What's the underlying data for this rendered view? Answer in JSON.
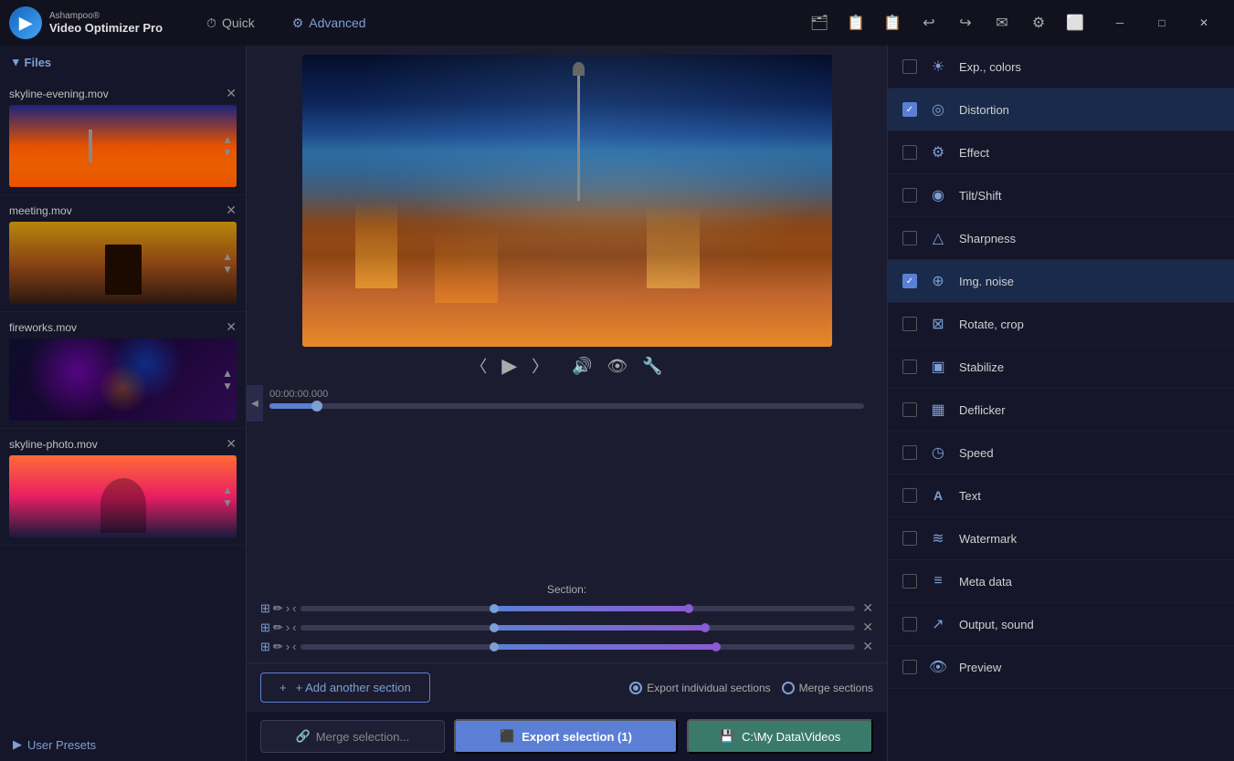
{
  "app": {
    "name_top": "Ashampoo®",
    "name_bottom": "Video Optimizer Pro"
  },
  "nav": {
    "quick_label": "Quick",
    "advanced_label": "Advanced",
    "quick_icon": "⏱",
    "advanced_icon": "⚙"
  },
  "titlebar_icons": [
    "🗂",
    "📋",
    "📋",
    "↩",
    "↪",
    "✉",
    "⚙",
    "⬜"
  ],
  "window_controls": {
    "minimize": "─",
    "maximize": "□",
    "close": "✕"
  },
  "sidebar": {
    "files_label": "Files",
    "files": [
      {
        "name": "skyline-evening.mov",
        "thumb_class": "thumb-skyline-evening"
      },
      {
        "name": "meeting.mov",
        "thumb_class": "thumb-meeting"
      },
      {
        "name": "fireworks.mov",
        "thumb_class": "thumb-fireworks"
      },
      {
        "name": "skyline-photo.mov",
        "thumb_class": "thumb-skyline-photo"
      }
    ],
    "user_presets_label": "User Presets"
  },
  "video": {
    "timestamp": "00:00:00.000",
    "section_label": "Section:"
  },
  "sections": [
    {
      "fill_left": "35%",
      "fill_right": "70%",
      "left_pos": "35%",
      "right_pos": "70%"
    },
    {
      "fill_left": "35%",
      "fill_right": "73%",
      "left_pos": "35%",
      "right_pos": "73%"
    },
    {
      "fill_left": "35%",
      "fill_right": "75%",
      "left_pos": "35%",
      "right_pos": "75%"
    }
  ],
  "export": {
    "individual_label": "Export individual sections",
    "merge_label": "Merge sections",
    "add_section_label": "+ Add another section"
  },
  "action_bar": {
    "merge_label": "Merge selection...",
    "export_label": "Export selection (1)",
    "path_label": "C:\\My Data\\Videos"
  },
  "right_panel": {
    "items": [
      {
        "id": "exp-colors",
        "label": "Exp., colors",
        "checked": false,
        "icon": "☀"
      },
      {
        "id": "distortion",
        "label": "Distortion",
        "checked": true,
        "icon": "◎"
      },
      {
        "id": "effect",
        "label": "Effect",
        "checked": false,
        "icon": "⚙"
      },
      {
        "id": "tilt-shift",
        "label": "Tilt/Shift",
        "checked": false,
        "icon": "◉"
      },
      {
        "id": "sharpness",
        "label": "Sharpness",
        "checked": false,
        "icon": "△"
      },
      {
        "id": "img-noise",
        "label": "Img. noise",
        "checked": true,
        "icon": "⊕"
      },
      {
        "id": "rotate-crop",
        "label": "Rotate, crop",
        "checked": false,
        "icon": "⊠"
      },
      {
        "id": "stabilize",
        "label": "Stabilize",
        "checked": false,
        "icon": "▣"
      },
      {
        "id": "deflicker",
        "label": "Deflicker",
        "checked": false,
        "icon": "▦"
      },
      {
        "id": "speed",
        "label": "Speed",
        "checked": false,
        "icon": "◷"
      },
      {
        "id": "text",
        "label": "Text",
        "checked": false,
        "icon": "A"
      },
      {
        "id": "watermark",
        "label": "Watermark",
        "checked": false,
        "icon": "≋"
      },
      {
        "id": "meta-data",
        "label": "Meta data",
        "checked": false,
        "icon": "≡"
      },
      {
        "id": "output-sound",
        "label": "Output, sound",
        "checked": false,
        "icon": "↗"
      },
      {
        "id": "preview",
        "label": "Preview",
        "checked": false,
        "icon": "👁"
      }
    ]
  }
}
